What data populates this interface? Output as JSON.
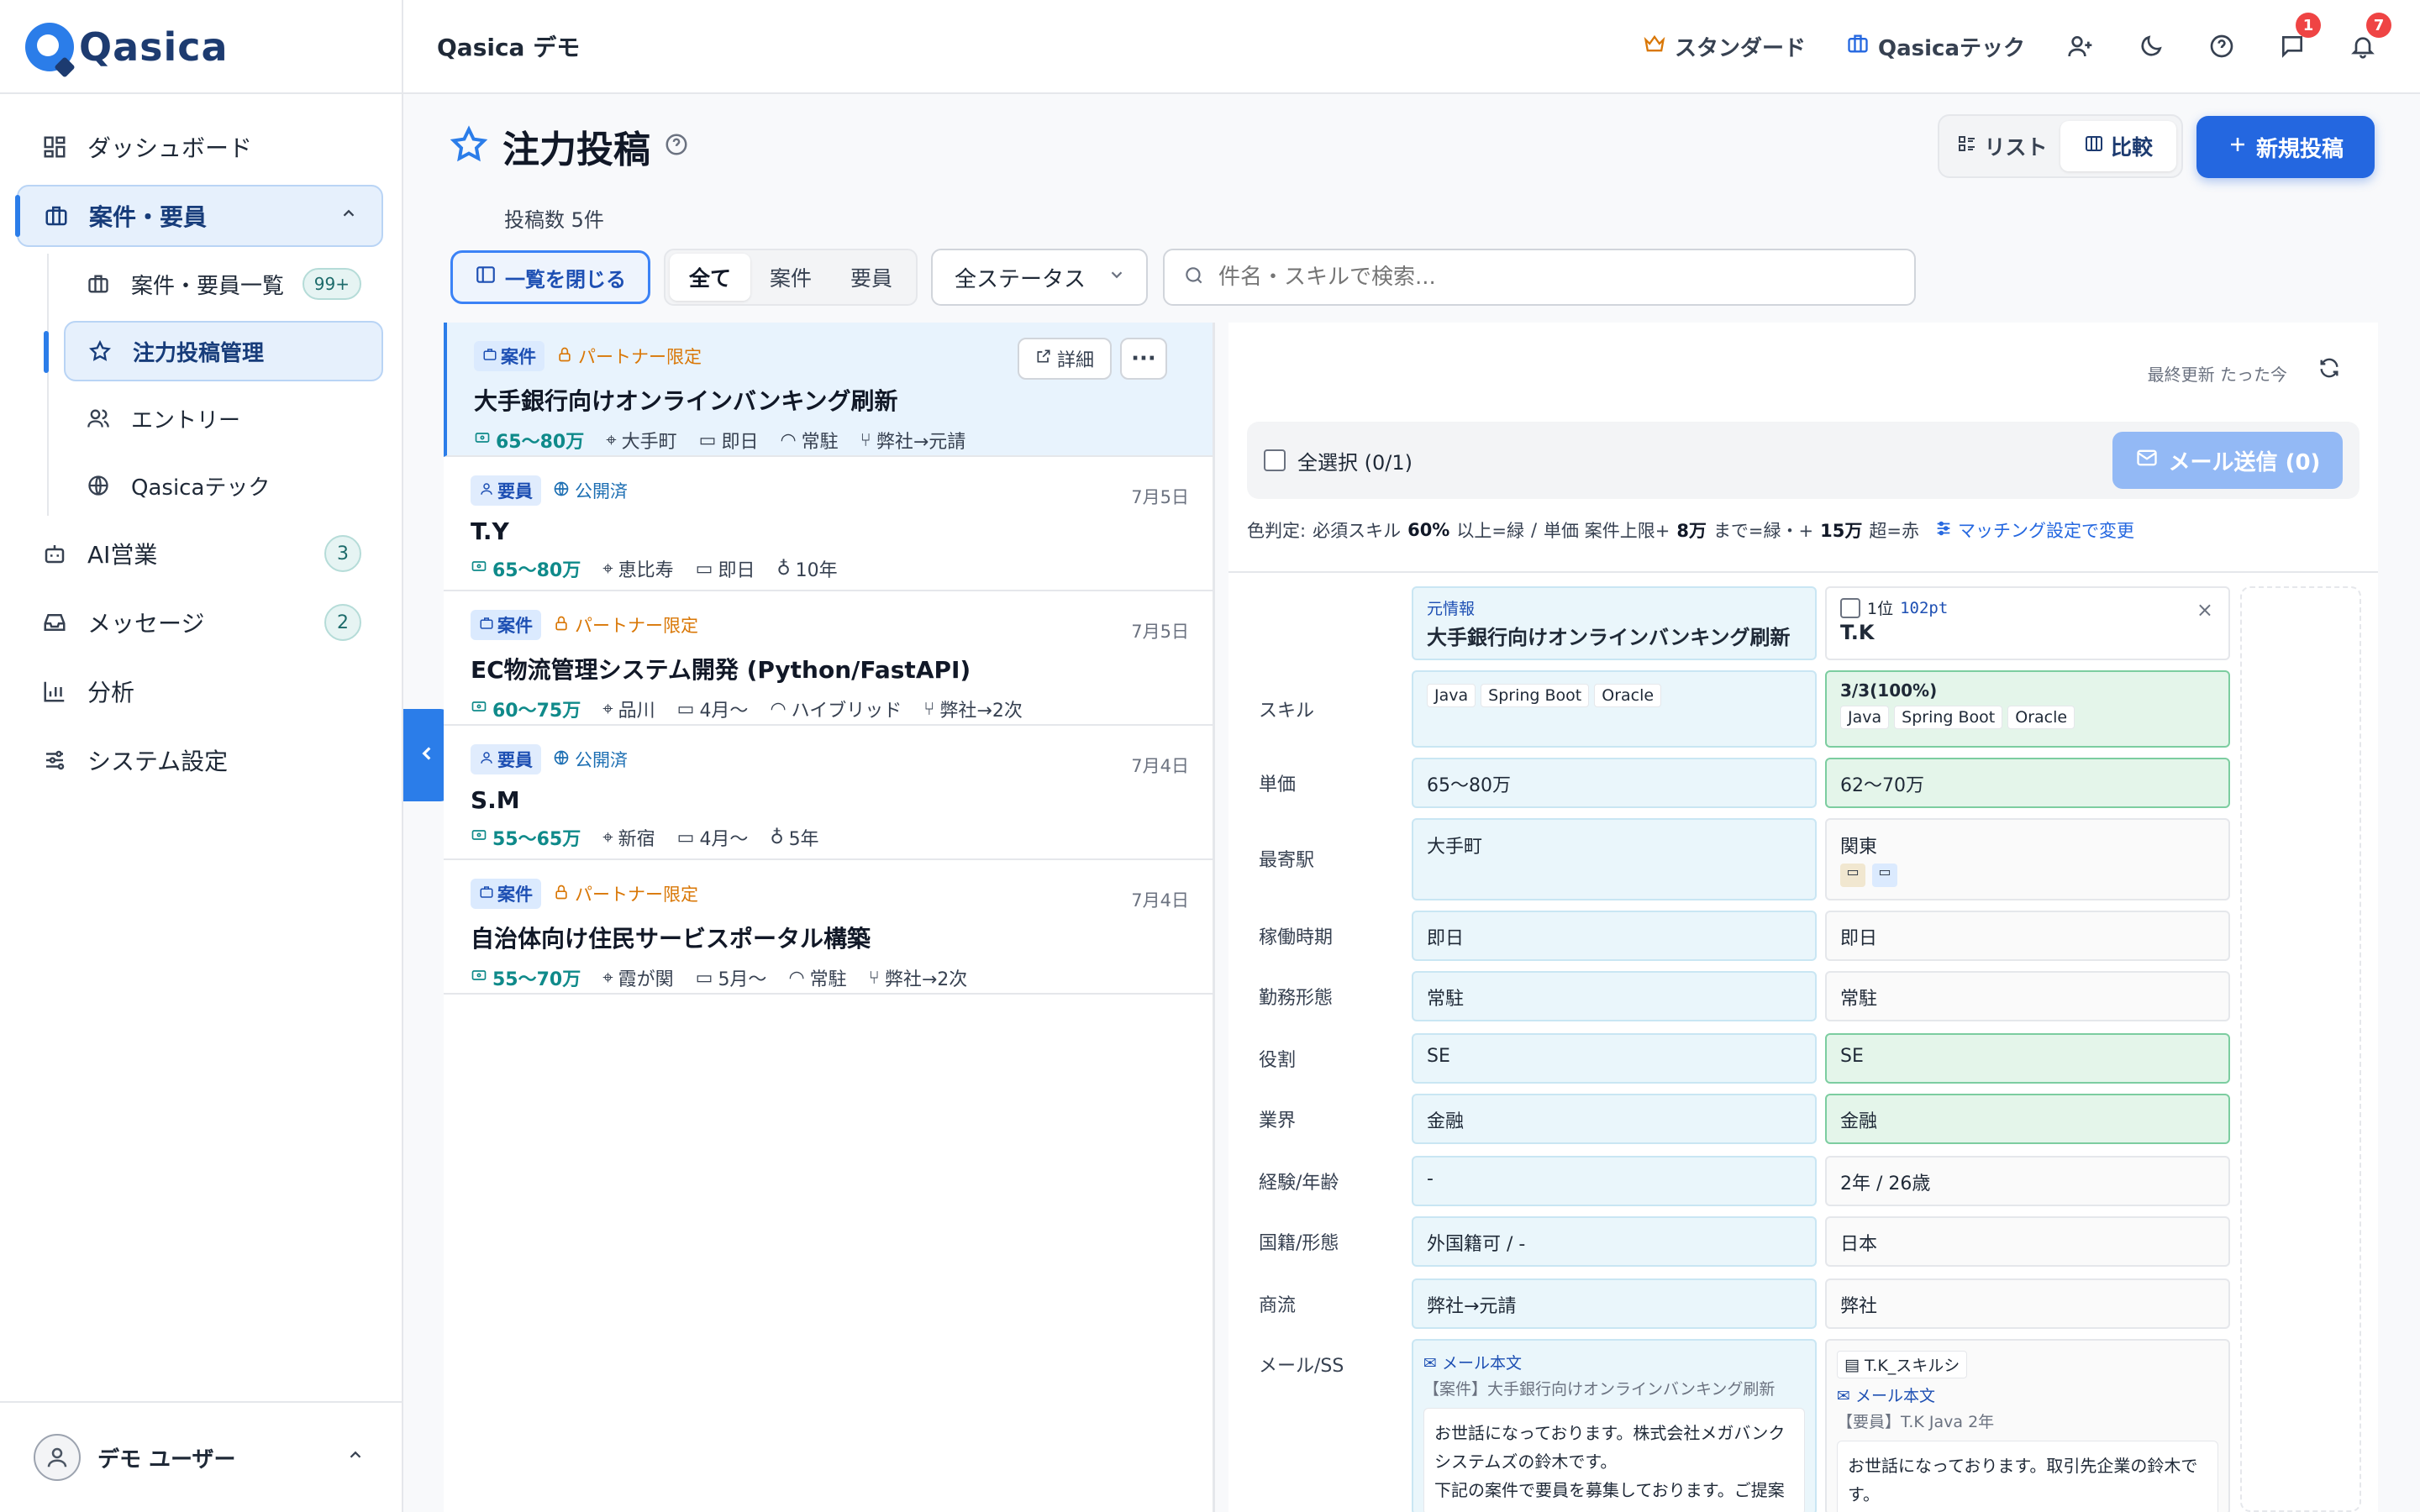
{
  "brand": {
    "name": "Qasica"
  },
  "sidebar": {
    "items": [
      {
        "label": "ダッシュボード"
      },
      {
        "label": "案件・要員"
      },
      {
        "label": "案件・要員一覧",
        "badge": "99+"
      },
      {
        "label": "注力投稿管理"
      },
      {
        "label": "エントリー"
      },
      {
        "label": "Qasicaテック"
      },
      {
        "label": "AI営業",
        "badge": "3"
      },
      {
        "label": "メッセージ",
        "badge": "2"
      },
      {
        "label": "分析"
      },
      {
        "label": "システム設定"
      }
    ],
    "user": {
      "name": "デモ ユーザー"
    }
  },
  "header": {
    "title": "Qasica デモ",
    "plan": "スタンダード",
    "tech": "Qasicaテック",
    "messages_count": "1",
    "notifications_count": "7"
  },
  "page": {
    "title": "注力投稿",
    "post_count": "投稿数 5件",
    "view_list": "リスト",
    "view_compare": "比較",
    "new_post": "新規投稿"
  },
  "filters": {
    "close_list": "一覧を閉じる",
    "seg": [
      "全て",
      "案件",
      "要員"
    ],
    "status": "全ステータス",
    "search_placeholder": "件名・スキルで検索..."
  },
  "posts": [
    {
      "type": "案件",
      "scope": "パートナー限定",
      "date": "",
      "title": "大手銀行向けオンラインバンキング刷新",
      "price": "65〜80万",
      "m1": "大手町",
      "m2": "即日",
      "m3": "常駐",
      "m4": "弊社→元請",
      "detail": "詳細"
    },
    {
      "type": "要員",
      "scope": "公開済",
      "date": "7月5日",
      "title": "T.Y",
      "price": "65〜80万",
      "m1": "恵比寿",
      "m2": "即日",
      "m3": "10年",
      "m4": ""
    },
    {
      "type": "案件",
      "scope": "パートナー限定",
      "date": "7月5日",
      "title": "EC物流管理システム開発 (Python/FastAPI)",
      "price": "60〜75万",
      "m1": "品川",
      "m2": "4月〜",
      "m3": "ハイブリッド",
      "m4": "弊社→2次"
    },
    {
      "type": "要員",
      "scope": "公開済",
      "date": "7月4日",
      "title": "S.M",
      "price": "55〜65万",
      "m1": "新宿",
      "m2": "4月〜",
      "m3": "5年",
      "m4": ""
    },
    {
      "type": "案件",
      "scope": "パートナー限定",
      "date": "7月4日",
      "title": "自治体向け住民サービスポータル構築",
      "price": "55〜70万",
      "m1": "霞が関",
      "m2": "5月〜",
      "m3": "常駐",
      "m4": "弊社→2次"
    }
  ],
  "compare": {
    "last_update": "最終更新 たった今",
    "select_all": "全選択 (0/1)",
    "mail_send": "メール送信 (0)",
    "rule_prefix": "色判定:",
    "rule_a": "必須スキル",
    "rule_b": "60%",
    "rule_c": "以上=緑",
    "rule_sep": "/",
    "rule_d": "単価 案件上限+",
    "rule_e": "8万",
    "rule_f": "まで=緑・+",
    "rule_g": "15万",
    "rule_h": "超=赤",
    "rule_link": "マッチング設定で変更",
    "source_label": "元情報",
    "source_title": "大手銀行向けオンラインバンキング刷新",
    "rank": "1位",
    "points": "102pt",
    "cand_name": "T.K",
    "labels": [
      "スキル",
      "単価",
      "最寄駅",
      "稼働時期",
      "勤務形態",
      "役割",
      "業界",
      "経験/年齢",
      "国籍/形態",
      "商流",
      "メール/SS"
    ],
    "skills_a": [
      "Java",
      "Spring Boot",
      "Oracle"
    ],
    "skill_ratio": "3/3(100%)",
    "skills_b": [
      "Java",
      "Spring Boot",
      "Oracle"
    ],
    "a": {
      "price": "65〜80万",
      "station": "大手町",
      "start": "即日",
      "work": "常駐",
      "role": "SE",
      "industry": "金融",
      "exp": "-",
      "nation": "外国籍可 / -",
      "flow": "弊社→元請"
    },
    "b": {
      "price": "62〜70万",
      "station": "関東",
      "start": "即日",
      "work": "常駐",
      "role": "SE",
      "industry": "金融",
      "exp": "2年 / 26歳",
      "nation": "日本",
      "flow": "弊社"
    },
    "mail_a_link": "メール本文",
    "mail_a_subject": "【案件】大手銀行向けオンラインバンキング刷新",
    "mail_a_body1": "お世話になっております。株式会社メガバンク",
    "mail_a_body2": "システムズの鈴木です。",
    "mail_a_body3": "下記の案件で要員を募集しております。ご提案",
    "mail_b_file": "T.K_スキルシ",
    "mail_b_link": "メール本文",
    "mail_b_subject": "【要員】T.K Java 2年",
    "mail_b_body1": "お世話になっております。取引先企業の鈴木で",
    "mail_b_body2": "す。"
  }
}
